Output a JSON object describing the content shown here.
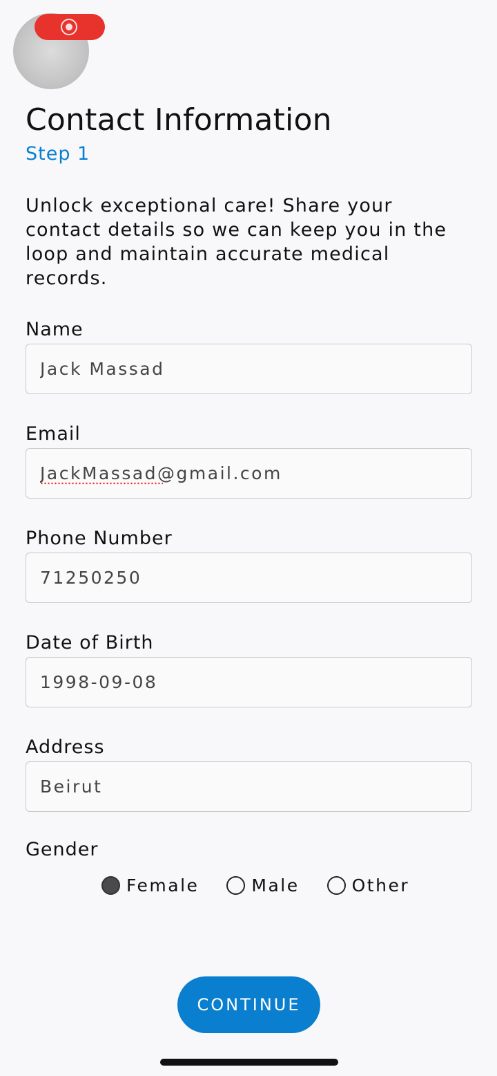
{
  "header": {
    "title": "Contact Information",
    "step": "Step 1"
  },
  "intro": "Unlock exceptional care! Share your contact details so we can keep you in the loop and maintain accurate medical records.",
  "fields": {
    "name": {
      "label": "Name",
      "value": "Jack Massad"
    },
    "email": {
      "label": "Email",
      "value": "JackMassad@gmail.com"
    },
    "phone": {
      "label": "Phone Number",
      "value": "71250250"
    },
    "dob": {
      "label": "Date of Birth",
      "value": "1998-09-08"
    },
    "address": {
      "label": "Address",
      "value": "Beirut"
    }
  },
  "gender": {
    "label": "Gender",
    "options": [
      "Female",
      "Male",
      "Other"
    ],
    "selected": "Female"
  },
  "continue_label": "CONTINUE",
  "colors": {
    "accent": "#0a7fcf",
    "recording": "#e8322c",
    "background": "#f8f8fa"
  }
}
